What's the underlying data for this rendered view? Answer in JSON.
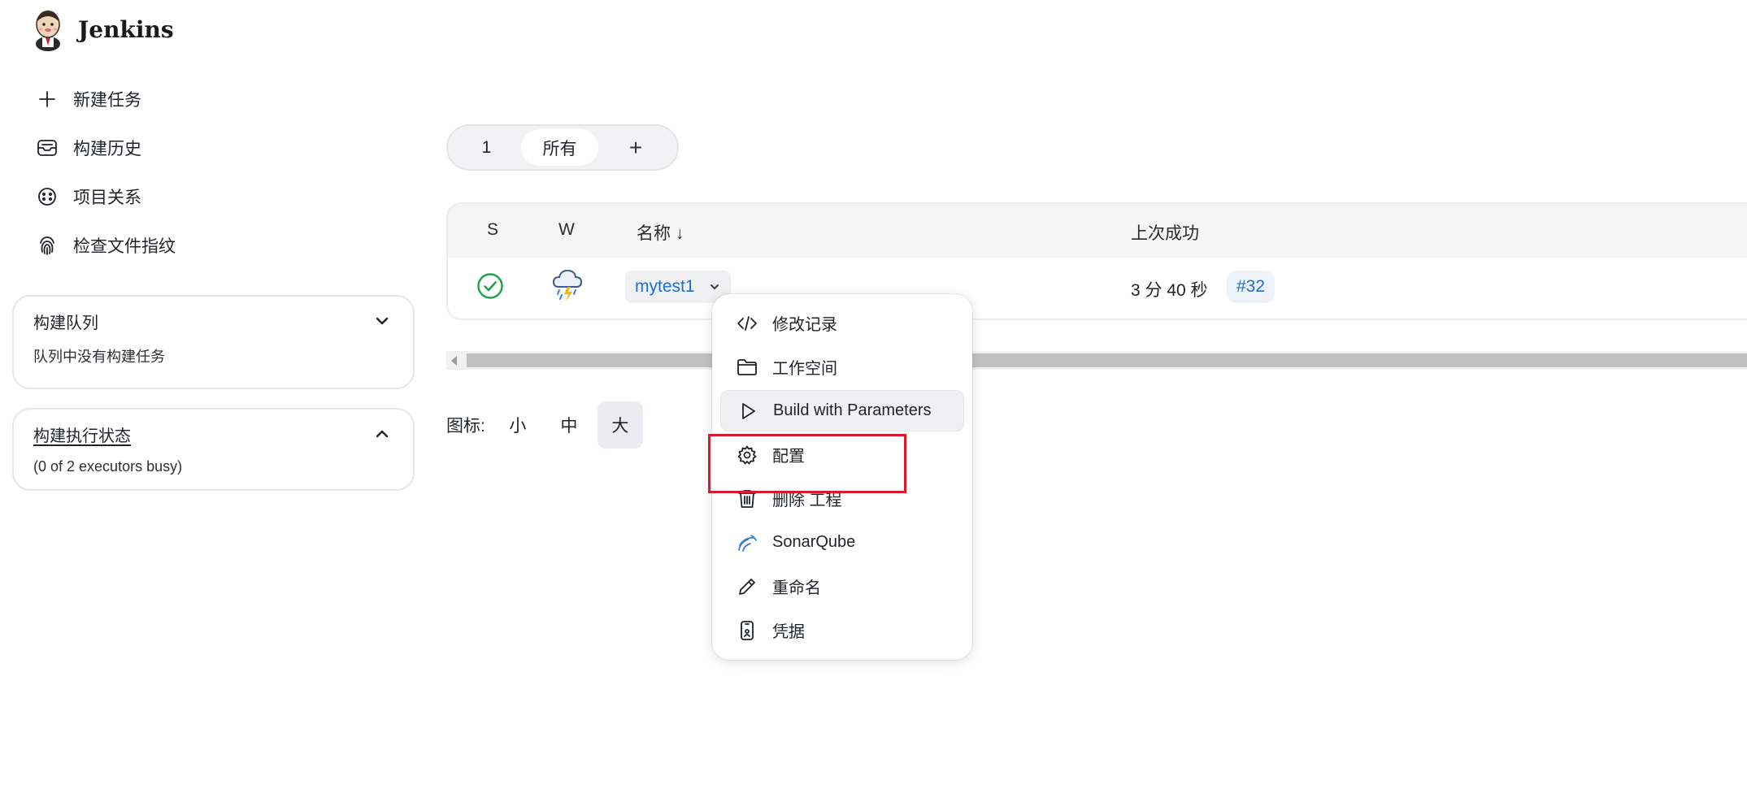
{
  "header": {
    "brand_name": "Jenkins",
    "logo_icon": "jenkins-butler-logo"
  },
  "sidenav": {
    "items": [
      {
        "label": "新建任务",
        "icon": "plus-icon"
      },
      {
        "label": "构建历史",
        "icon": "inbox-icon"
      },
      {
        "label": "项目关系",
        "icon": "relationship-icon"
      },
      {
        "label": "检查文件指纹",
        "icon": "fingerprint-icon"
      }
    ]
  },
  "build_queue": {
    "title": "构建队列",
    "empty_text": "队列中没有构建任务"
  },
  "executor_status": {
    "title": "构建执行状态",
    "text": "(0 of 2 executors busy)"
  },
  "view_tabs": {
    "tabs": [
      "1",
      "所有"
    ],
    "active": "所有",
    "add_label": "+"
  },
  "jobs_table": {
    "columns": {
      "s": "S",
      "w": "W",
      "name": "名称 ↓",
      "last_success": "上次成功"
    },
    "rows": [
      {
        "status": "success",
        "weather": "thunderstorm",
        "name": "mytest1",
        "last_success_time": "3 分 40 秒",
        "last_success_build": "#32"
      }
    ]
  },
  "icon_size": {
    "label": "图标:",
    "options": [
      "小",
      "中",
      "大"
    ],
    "active": "大"
  },
  "job_menu": {
    "items": [
      {
        "label": "修改记录",
        "icon": "code-icon"
      },
      {
        "label": "工作空间",
        "icon": "folder-icon"
      },
      {
        "label": "Build with Parameters",
        "icon": "play-icon"
      },
      {
        "label": "配置",
        "icon": "gear-icon"
      },
      {
        "label": "删除 工程",
        "icon": "trash-icon"
      },
      {
        "label": "SonarQube",
        "icon": "sonarqube-icon"
      },
      {
        "label": "重命名",
        "icon": "pencil-icon"
      },
      {
        "label": "凭据",
        "icon": "credentials-icon"
      }
    ],
    "hovered": "Build with Parameters",
    "highlighted": "配置"
  },
  "colors": {
    "link": "#1a6fcf",
    "success": "#1ea446",
    "highlight_box": "#d9192e"
  }
}
